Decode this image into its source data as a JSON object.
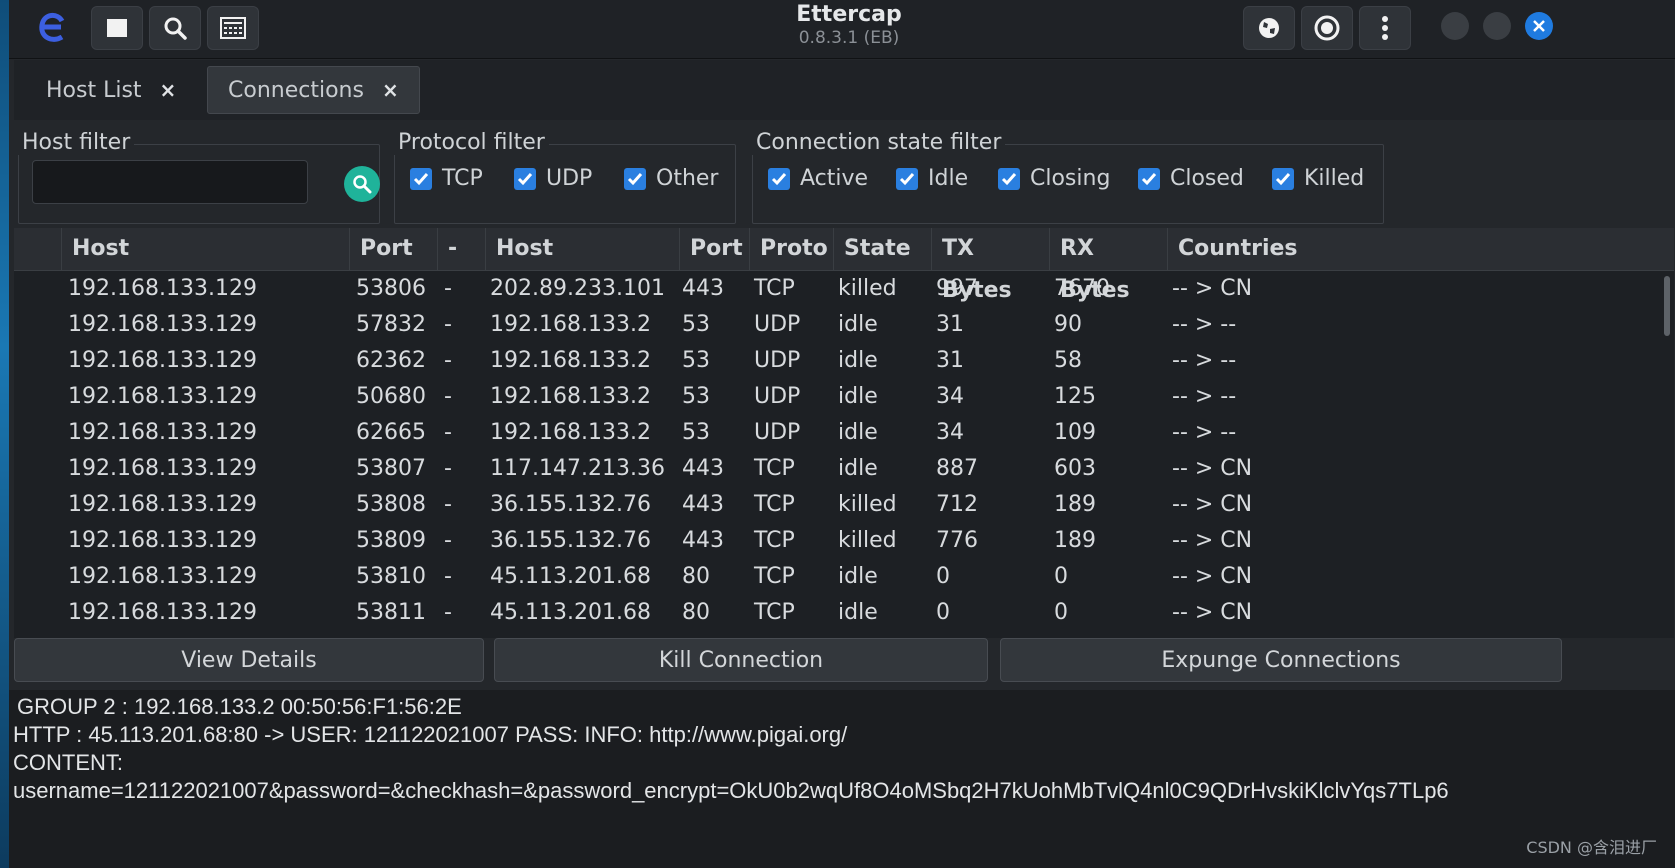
{
  "window": {
    "title": "Ettercap",
    "subtitle": "0.8.3.1 (EB)"
  },
  "tabs": [
    {
      "label": "Host List",
      "close": "×"
    },
    {
      "label": "Connections",
      "close": "×"
    }
  ],
  "filters": {
    "host_label": "Host filter",
    "host_value": "",
    "protocol_label": "Protocol filter",
    "protocols": [
      "TCP",
      "UDP",
      "Other"
    ],
    "state_label": "Connection state filter",
    "states": [
      "Active",
      "Idle",
      "Closing",
      "Closed",
      "Killed"
    ]
  },
  "table": {
    "columns": [
      "Host",
      "Port",
      "-",
      "Host",
      "Port",
      "Proto",
      "State",
      "TX Bytes",
      "RX Bytes",
      "Countries"
    ],
    "rows": [
      [
        "192.168.133.129",
        "53806",
        "-",
        "202.89.233.101",
        "443",
        "TCP",
        "killed",
        "997",
        "7670",
        "-- > CN"
      ],
      [
        "192.168.133.129",
        "57832",
        "-",
        "192.168.133.2",
        "53",
        "UDP",
        "idle",
        "31",
        "90",
        "-- > --"
      ],
      [
        "192.168.133.129",
        "62362",
        "-",
        "192.168.133.2",
        "53",
        "UDP",
        "idle",
        "31",
        "58",
        "-- > --"
      ],
      [
        "192.168.133.129",
        "50680",
        "-",
        "192.168.133.2",
        "53",
        "UDP",
        "idle",
        "34",
        "125",
        "-- > --"
      ],
      [
        "192.168.133.129",
        "62665",
        "-",
        "192.168.133.2",
        "53",
        "UDP",
        "idle",
        "34",
        "109",
        "-- > --"
      ],
      [
        "192.168.133.129",
        "53807",
        "-",
        "117.147.213.36",
        "443",
        "TCP",
        "idle",
        "887",
        "603",
        "-- > CN"
      ],
      [
        "192.168.133.129",
        "53808",
        "-",
        "36.155.132.76",
        "443",
        "TCP",
        "killed",
        "712",
        "189",
        "-- > CN"
      ],
      [
        "192.168.133.129",
        "53809",
        "-",
        "36.155.132.76",
        "443",
        "TCP",
        "killed",
        "776",
        "189",
        "-- > CN"
      ],
      [
        "192.168.133.129",
        "53810",
        "-",
        "45.113.201.68",
        "80",
        "TCP",
        "idle",
        "0",
        "0",
        "-- > CN"
      ],
      [
        "192.168.133.129",
        "53811",
        "-",
        "45.113.201.68",
        "80",
        "TCP",
        "idle",
        "0",
        "0",
        "-- > CN"
      ]
    ]
  },
  "actions": {
    "view_details": "View Details",
    "kill_connection": "Kill Connection",
    "expunge": "Expunge Connections"
  },
  "log": {
    "lines": [
      "GROUP 2 : 192.168.133.2 00:50:56:F1:56:2E",
      "HTTP : 45.113.201.68:80 -> USER: 121122021007  PASS:   INFO: http://www.pigai.org/",
      "CONTENT:",
      "username=121122021007&password=&checkhash=&password_encrypt=OkU0b2wqUf8O4oMSbq2H7kUohMbTvlQ4nl0C9QDrHvskiKlclvYqs7TLp6"
    ]
  },
  "watermark": "CSDN @含泪进厂",
  "icons": {
    "app": "ettercap-logo-icon",
    "stop": "stop-icon",
    "search": "search-icon",
    "hosts": "host-list-icon",
    "mitm": "globe-icon",
    "filters": "record-icon",
    "menu": "kebab-menu-icon",
    "close": "close-icon"
  },
  "colors": {
    "accent": "#2a7fe0",
    "search_button": "#1fb39a",
    "window_close": "#1f7be0"
  }
}
